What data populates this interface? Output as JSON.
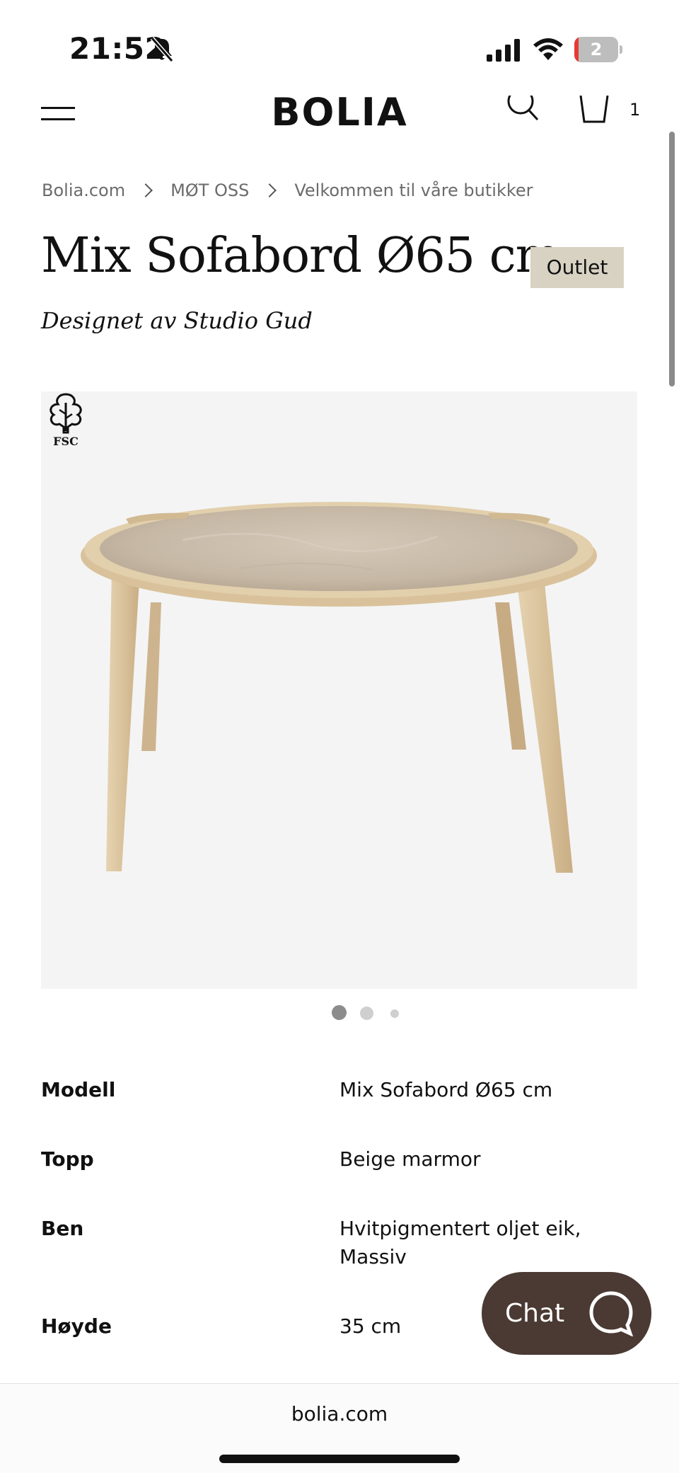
{
  "status_bar": {
    "time": "21:52",
    "battery_level": "2",
    "battery_color": "#e53935"
  },
  "header": {
    "logo": "BOLIA",
    "cart_count": "1",
    "icons": [
      "menu-icon",
      "search-icon",
      "cart-icon"
    ]
  },
  "breadcrumb": {
    "items": [
      "Bolia.com",
      "MØT OSS",
      "Velkommen til våre butikker"
    ]
  },
  "product": {
    "title": "Mix Sofabord Ø65 cm",
    "badge": "Outlet",
    "designer": "Designet av Studio Gud",
    "fsc_label": "FSC",
    "image_count": 3,
    "active_image": 1
  },
  "specs": [
    {
      "label": "Modell",
      "value": "Mix Sofabord Ø65 cm"
    },
    {
      "label": "Topp",
      "value": "Beige marmor"
    },
    {
      "label": "Ben",
      "value": "Hvitpigmentert oljet eik, Massiv"
    },
    {
      "label": "Høyde",
      "value": "35 cm"
    }
  ],
  "chat": {
    "label": "Chat",
    "color": "#4a3a33"
  },
  "browser": {
    "url": "bolia.com"
  },
  "colors": {
    "badge_bg": "#d8d2c3",
    "image_bg": "#f4f4f4"
  }
}
